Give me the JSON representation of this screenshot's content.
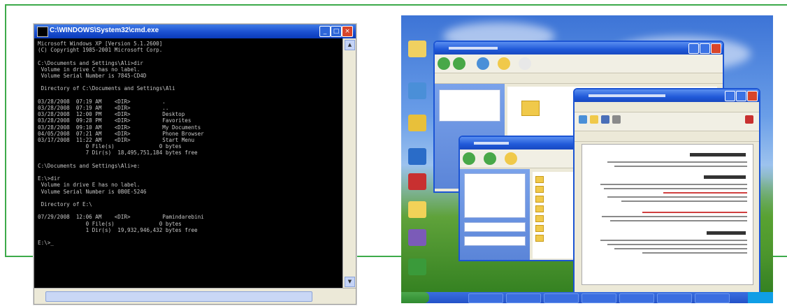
{
  "cmd": {
    "title": "C:\\WINDOWS\\System32\\cmd.exe",
    "lines": [
      "Microsoft Windows XP [Version 5.1.2600]",
      "(C) Copyright 1985-2001 Microsoft Corp.",
      "",
      "C:\\Documents and Settings\\Ali>dir",
      " Volume in drive C has no label.",
      " Volume Serial Number is 7845-CD4D",
      "",
      " Directory of C:\\Documents and Settings\\Ali",
      "",
      "03/28/2008  07:19 AM    <DIR>          .",
      "03/28/2008  07:19 AM    <DIR>          ..",
      "03/28/2008  12:00 PM    <DIR>          Desktop",
      "03/28/2008  09:28 PM    <DIR>          Favorites",
      "03/28/2008  09:10 AM    <DIR>          My Documents",
      "04/05/2008  07:21 AM    <DIR>          Phone Browser",
      "03/17/2008  11:22 AM    <DIR>          Start Menu",
      "               0 File(s)              0 bytes",
      "               7 Dir(s)  18,495,751,184 bytes free",
      "",
      "C:\\Documents and Settings\\Ali>e:",
      "",
      "E:\\>dir",
      " Volume in drive E has no label.",
      " Volume Serial Number is 0B0E-5246",
      "",
      " Directory of E:\\",
      "",
      "07/29/2008  12:06 AM    <DIR>          Pamindarebini",
      "               0 File(s)              0 bytes",
      "               1 Dir(s)  19,932,946,432 bytes free",
      "",
      "E:\\>_"
    ]
  }
}
